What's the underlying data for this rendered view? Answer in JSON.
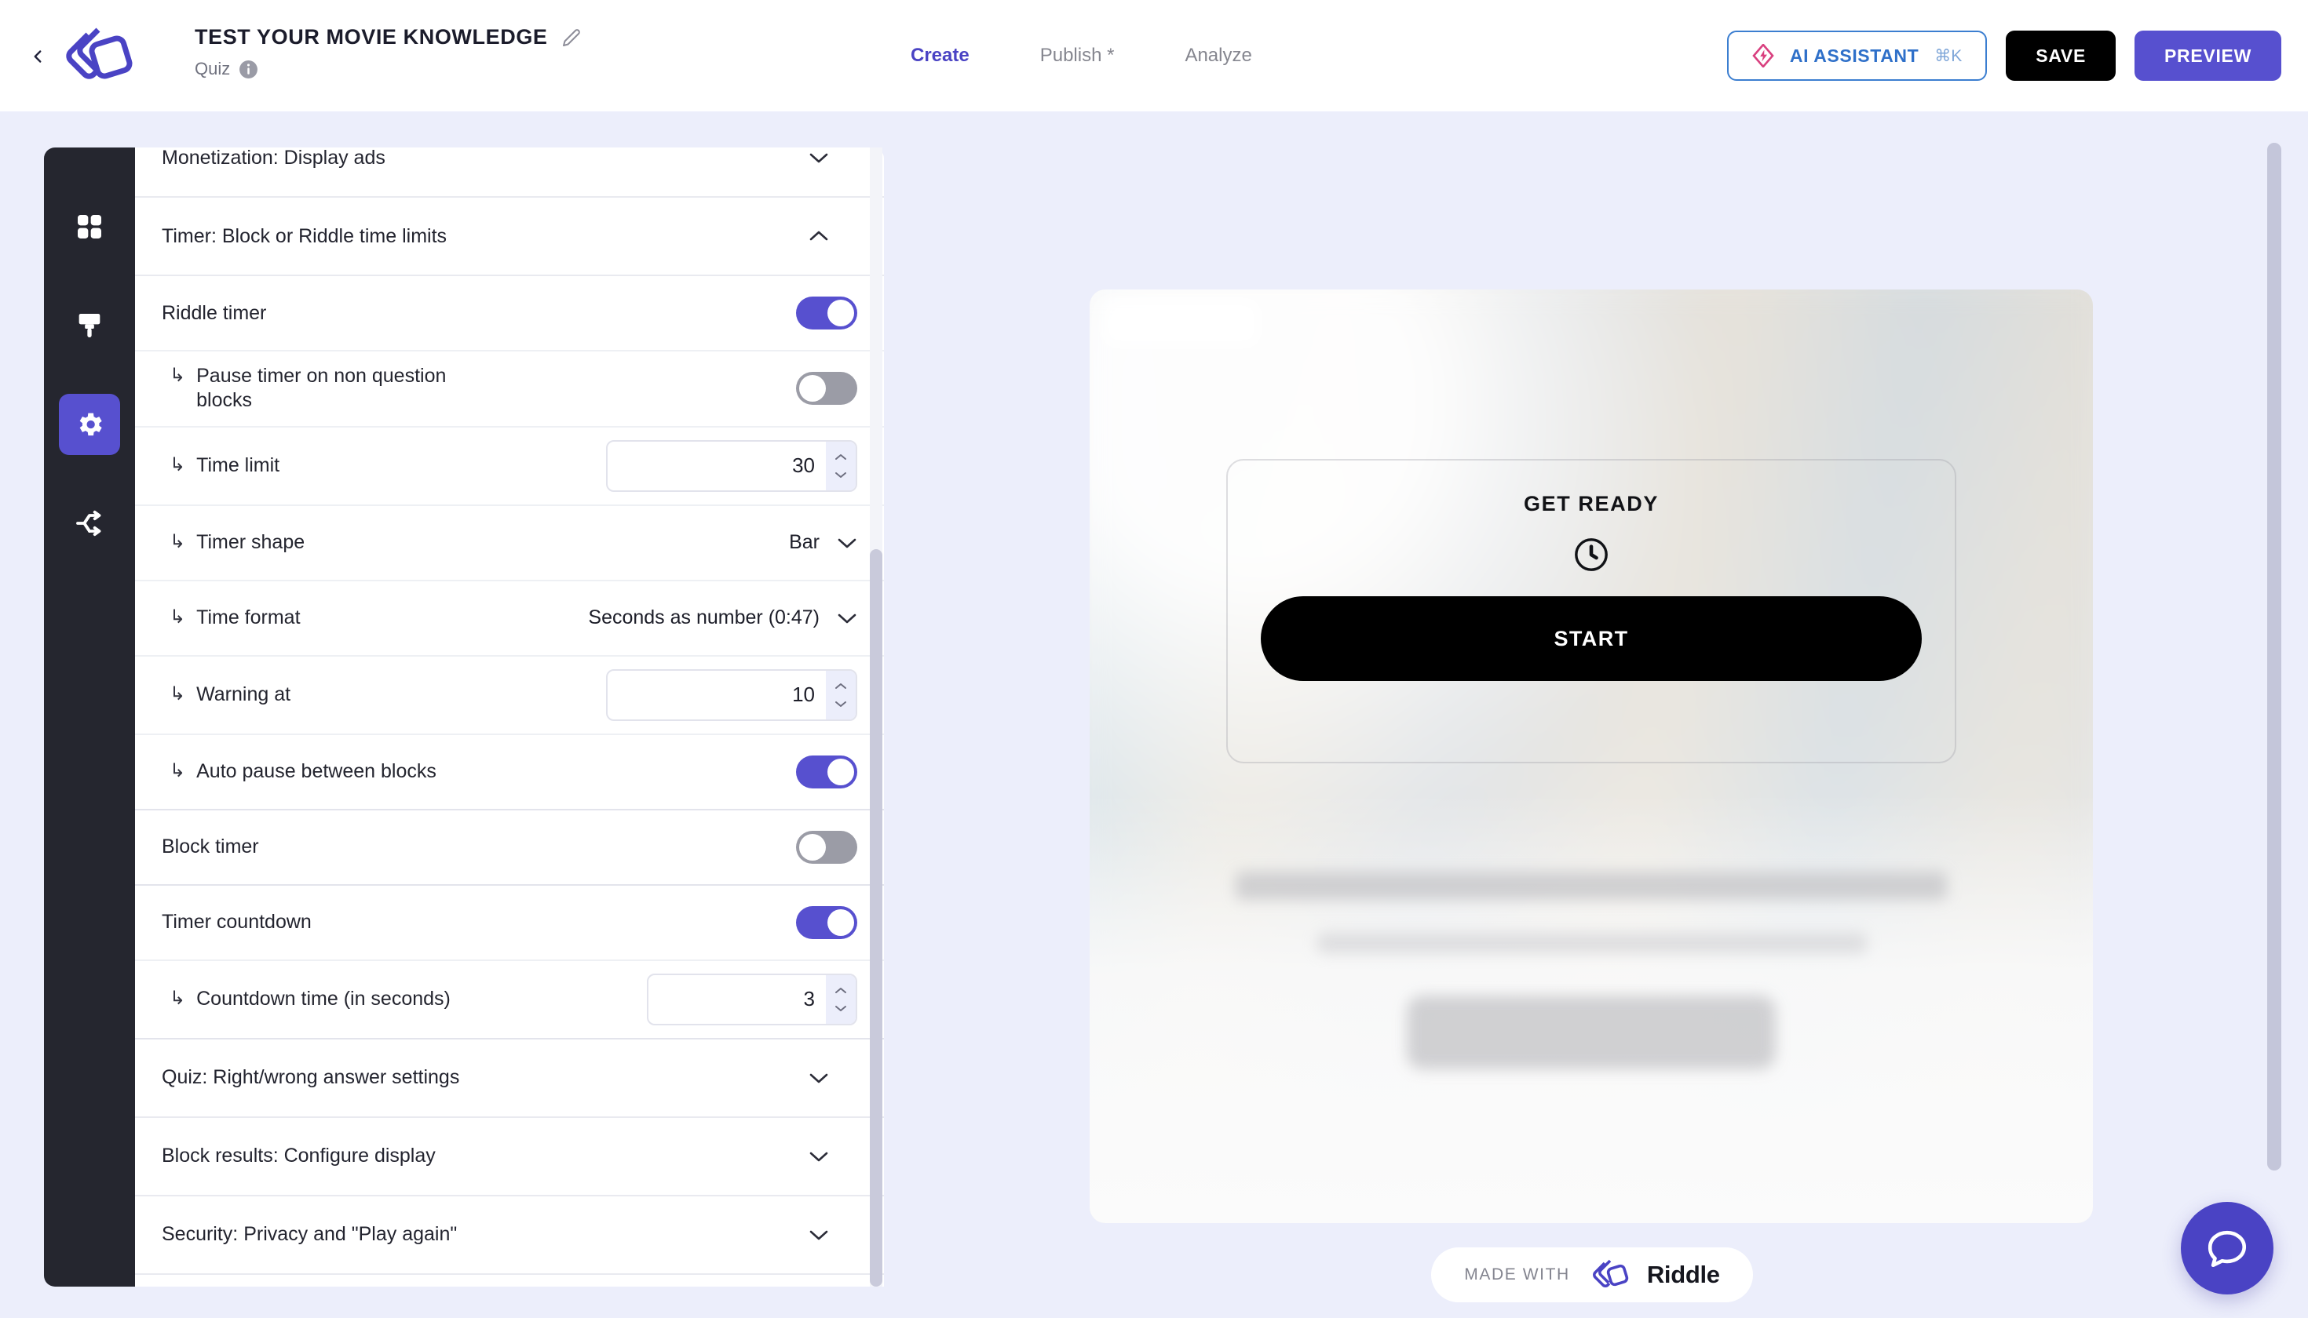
{
  "header": {
    "back_icon": "chevron-left-icon",
    "logo_icon": "riddle-logo",
    "title": "TEST YOUR MOVIE KNOWLEDGE",
    "edit_icon": "pencil-icon",
    "subtitle": "Quiz",
    "info_icon": "info-icon",
    "tabs": [
      {
        "label": "Create",
        "active": true
      },
      {
        "label": "Publish *",
        "active": false
      },
      {
        "label": "Analyze",
        "active": false
      }
    ],
    "ai_button": {
      "label": "AI ASSISTANT",
      "shortcut": "⌘K",
      "icon": "spark-diamond-icon"
    },
    "save_label": "SAVE",
    "preview_label": "PREVIEW"
  },
  "rail": {
    "items": [
      {
        "icon": "grid-blocks-icon",
        "active": false
      },
      {
        "icon": "paintbrush-icon",
        "active": false
      },
      {
        "icon": "gear-icon",
        "active": true
      },
      {
        "icon": "share-nodes-icon",
        "active": false
      }
    ]
  },
  "settings": {
    "sections": [
      {
        "label": "Monetization: Display ads",
        "expanded": false
      },
      {
        "label": "Timer: Block or Riddle time limits",
        "expanded": true
      }
    ],
    "rows": [
      {
        "label": "Riddle timer",
        "sub": false,
        "control": "toggle",
        "value": "on"
      },
      {
        "label": "Pause timer on non question blocks",
        "sub": true,
        "control": "toggle",
        "value": "off"
      },
      {
        "label": "Time limit",
        "sub": true,
        "control": "number",
        "value": "30"
      },
      {
        "label": "Timer shape",
        "sub": true,
        "control": "select",
        "value": "Bar"
      },
      {
        "label": "Time format",
        "sub": true,
        "control": "select",
        "value": "Seconds as number (0:47)"
      },
      {
        "label": "Warning at",
        "sub": true,
        "control": "number",
        "value": "10"
      },
      {
        "label": "Auto pause between blocks",
        "sub": true,
        "control": "toggle",
        "value": "on"
      },
      {
        "label": "Block timer",
        "sub": false,
        "control": "toggle",
        "value": "off"
      },
      {
        "label": "Timer countdown",
        "sub": false,
        "control": "toggle",
        "value": "on"
      },
      {
        "label": "Countdown time (in seconds)",
        "sub": true,
        "control": "number",
        "value": "3"
      }
    ],
    "sections_bottom": [
      {
        "label": "Quiz: Right/wrong answer settings",
        "expanded": false
      },
      {
        "label": "Block results: Configure display",
        "expanded": false
      },
      {
        "label": "Security: Privacy and \"Play again\"",
        "expanded": false
      }
    ],
    "sub_arrow": "↳"
  },
  "preview": {
    "get_ready_title": "GET READY",
    "clock_icon": "clock-icon",
    "start_label": "START",
    "made_with_label": "MADE WITH",
    "made_with_brand": "Riddle",
    "made_with_icon": "riddle-logo"
  },
  "chat": {
    "icon": "chat-bubble-icon"
  },
  "colors": {
    "accent_purple": "#5750cf",
    "toggle_on": "#5750cf",
    "toggle_off": "#9b9ca6",
    "rail_bg": "#25262f",
    "page_bg": "#eceefb",
    "ai_blue": "#2f70c9",
    "ai_spark_pink": "#d9407f"
  }
}
